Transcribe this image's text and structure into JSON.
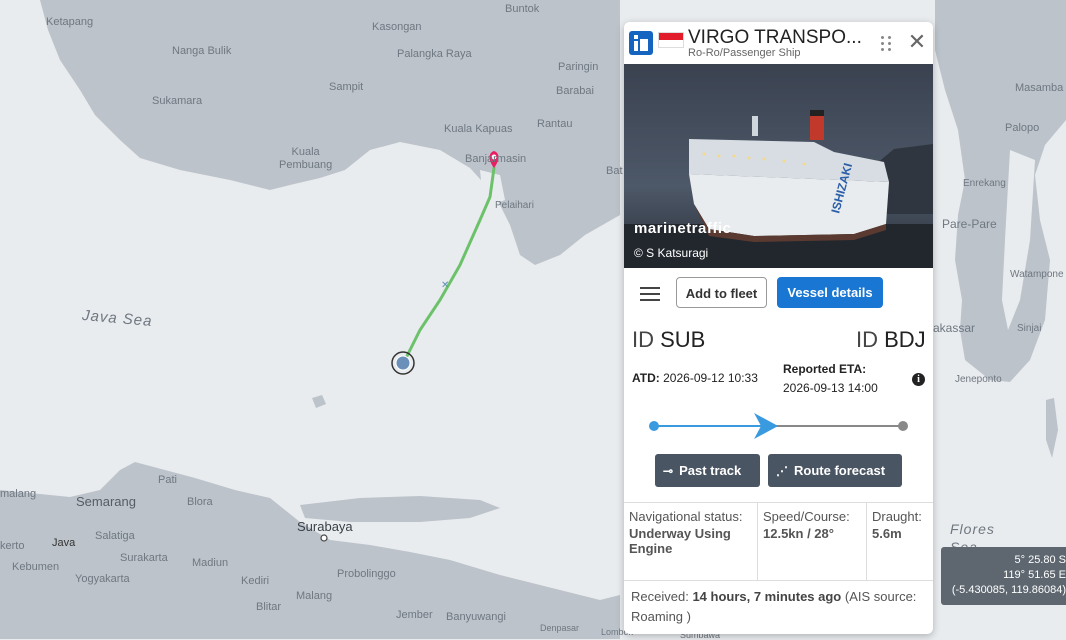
{
  "map": {
    "places": [
      {
        "id": "ketapang",
        "label": "Ketapang"
      },
      {
        "id": "buntok",
        "label": "Buntok"
      },
      {
        "id": "kasongan",
        "label": "Kasongan"
      },
      {
        "id": "nanga-bulik",
        "label": "Nanga Bulik"
      },
      {
        "id": "palangka-raya",
        "label": "Palangka Raya"
      },
      {
        "id": "paringin",
        "label": "Paringin"
      },
      {
        "id": "sukamara",
        "label": "Sukamara"
      },
      {
        "id": "sampit",
        "label": "Sampit"
      },
      {
        "id": "barabai",
        "label": "Barabai"
      },
      {
        "id": "masamba",
        "label": "Masamba"
      },
      {
        "id": "kuala-kapuas",
        "label": "Kuala Kapuas"
      },
      {
        "id": "rantau",
        "label": "Rantau"
      },
      {
        "id": "palopo",
        "label": "Palopo"
      },
      {
        "id": "kuala-pembuang",
        "label": "Kuala\nPembuang"
      },
      {
        "id": "banjarmasin",
        "label": "Banjarmasin"
      },
      {
        "id": "bat",
        "label": "Bat"
      },
      {
        "id": "enrekang",
        "label": "Enrekang"
      },
      {
        "id": "pelaihari",
        "label": "Pelaihari"
      },
      {
        "id": "pare-pare",
        "label": "Pare-Pare"
      },
      {
        "id": "java-sea",
        "label": "Java Sea"
      },
      {
        "id": "watampone",
        "label": "Watampone"
      },
      {
        "id": "makassar",
        "label": "akassar"
      },
      {
        "id": "sinjai",
        "label": "Sinjai"
      },
      {
        "id": "jeneponto",
        "label": "Jeneponto"
      },
      {
        "id": "malang-w",
        "label": "malang"
      },
      {
        "id": "semarang",
        "label": "Semarang"
      },
      {
        "id": "pati",
        "label": "Pati"
      },
      {
        "id": "blora",
        "label": "Blora"
      },
      {
        "id": "surabaya",
        "label": "Surabaya"
      },
      {
        "id": "kerto",
        "label": "kerto"
      },
      {
        "id": "java",
        "label": "Java"
      },
      {
        "id": "salatiga",
        "label": "Salatiga"
      },
      {
        "id": "surakarta",
        "label": "Surakarta"
      },
      {
        "id": "madiun",
        "label": "Madiun"
      },
      {
        "id": "kebumen",
        "label": "Kebumen"
      },
      {
        "id": "yogyakarta",
        "label": "Yogyakarta"
      },
      {
        "id": "kediri",
        "label": "Kediri"
      },
      {
        "id": "probolinggo",
        "label": "Probolinggo"
      },
      {
        "id": "flores-sea",
        "label": "Flores\nSea"
      },
      {
        "id": "blitar",
        "label": "Blitar"
      },
      {
        "id": "malang",
        "label": "Malang"
      },
      {
        "id": "jember",
        "label": "Jember"
      },
      {
        "id": "banyuwangi",
        "label": "Banyuwangi"
      },
      {
        "id": "denpasar",
        "label": "Denpasar"
      },
      {
        "id": "lombok",
        "label": "Lombok"
      },
      {
        "id": "sumbawa",
        "label": "Sumbawa"
      }
    ]
  },
  "vessel": {
    "name": "VIRGO TRANSPO...",
    "type": "Ro-Ro/Passenger Ship",
    "type_badge": "i",
    "flag_colors": {
      "top": "#e21c2a",
      "bottom": "#ffffff"
    },
    "photo_watermark": "marinetraffic",
    "photo_credit": "© S Katsuragi",
    "icons": {
      "type": "ship-type-icon",
      "drag": "drag-handle-icon",
      "close": "close-icon",
      "menu": "hamburger-menu-icon",
      "info": "info-icon",
      "past_track": "track-icon",
      "forecast": "route-forecast-icon"
    }
  },
  "actions": {
    "add_fleet": "Add to fleet",
    "vessel_details": "Vessel details",
    "past_track": "Past track",
    "route_forecast": "Route forecast"
  },
  "voyage": {
    "origin_prefix": "ID",
    "origin_code": "SUB",
    "dest_prefix": "ID",
    "dest_code": "BDJ",
    "atd_label": "ATD:",
    "atd_value": "2026-09-12 10:33",
    "eta_label": "Reported ETA:",
    "eta_value": "2026-09-13 14:00",
    "progress": 0.45,
    "colors": {
      "done": "#3a9ae0",
      "remaining": "#888888"
    }
  },
  "status": {
    "nav_label": "Navigational status:",
    "nav_value": "Underway Using Engine",
    "speed_label": "Speed/Course:",
    "speed_value": "12.5kn / 28°",
    "draught_label": "Draught:",
    "draught_value": "5.6m",
    "received_label": "Received:",
    "received_value": "14 hours, 7 minutes ago",
    "received_suffix": "(AIS source: Roaming )"
  },
  "coords": {
    "line1": "5° 25.80 S",
    "line2": "119° 51.65 E",
    "line3": "(-5.430085, 119.86084)"
  },
  "colors": {
    "sea": "#e9ecef",
    "land": "#bcc3ca",
    "track": "#6cc26a",
    "accent": "#1976d2"
  }
}
